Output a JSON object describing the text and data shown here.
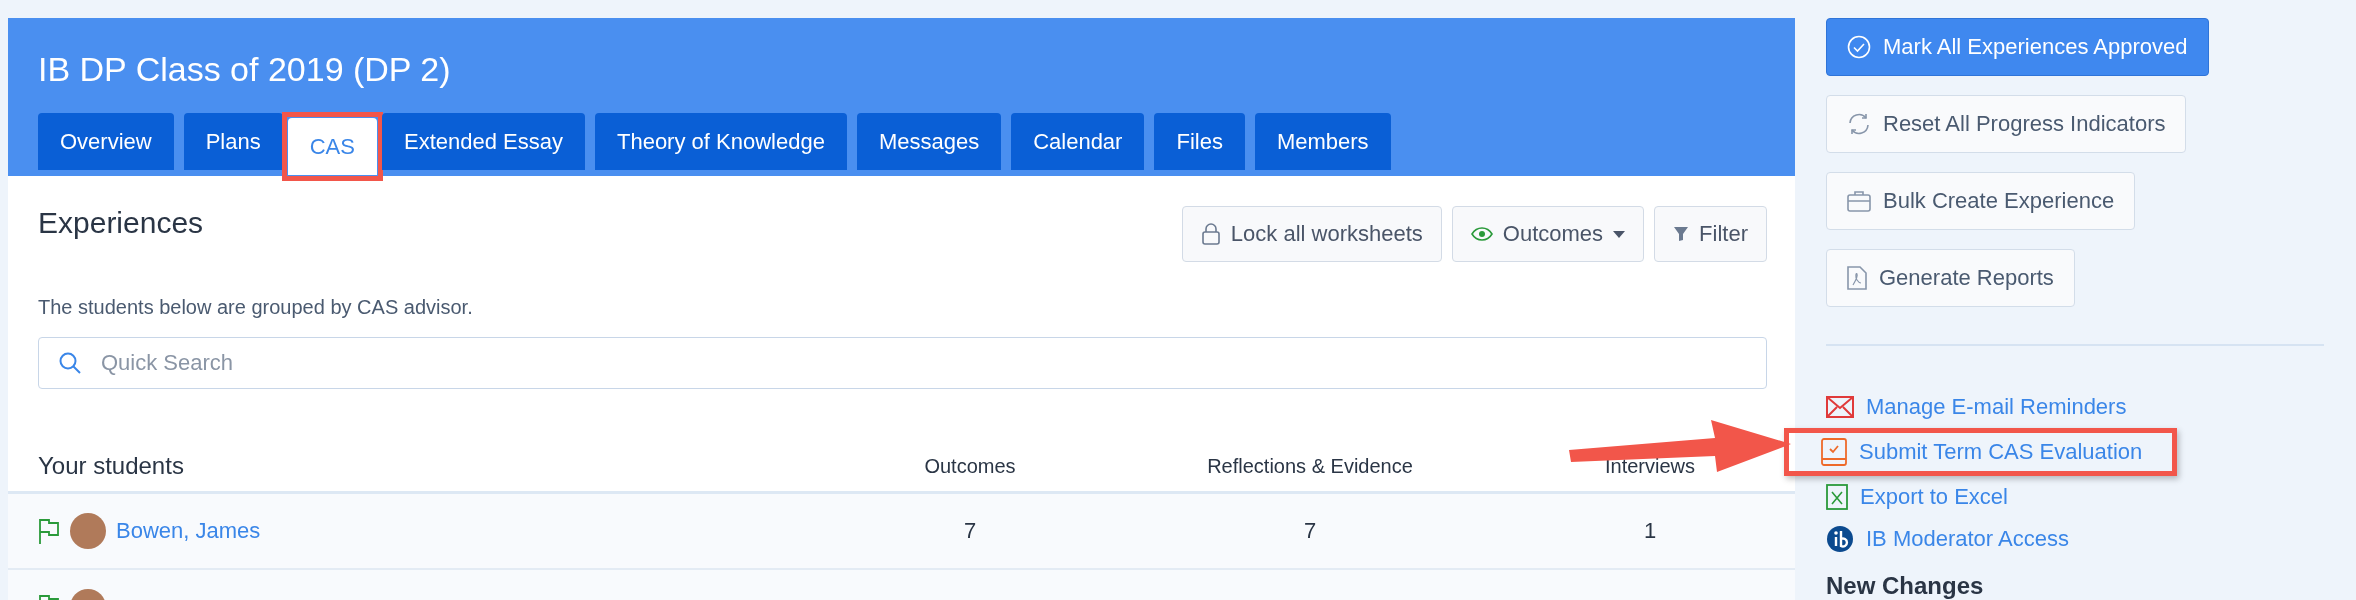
{
  "header": {
    "title": "IB DP Class of 2019 (DP 2)"
  },
  "tabs": [
    {
      "label": "Overview",
      "selected": false,
      "highlighted": false
    },
    {
      "label": "Plans",
      "selected": false,
      "highlighted": false
    },
    {
      "label": "CAS",
      "selected": true,
      "highlighted": true
    },
    {
      "label": "Extended Essay",
      "selected": false,
      "highlighted": false
    },
    {
      "label": "Theory of Knowledge",
      "selected": false,
      "highlighted": false
    },
    {
      "label": "Messages",
      "selected": false,
      "highlighted": false
    },
    {
      "label": "Calendar",
      "selected": false,
      "highlighted": false
    },
    {
      "label": "Files",
      "selected": false,
      "highlighted": false
    },
    {
      "label": "Members",
      "selected": false,
      "highlighted": false
    }
  ],
  "section": {
    "title": "Experiences",
    "description": "The students below are grouped by CAS advisor."
  },
  "toolbar": [
    {
      "kind": "lock",
      "label": "Lock all worksheets"
    },
    {
      "kind": "outcomes",
      "label": "Outcomes"
    },
    {
      "kind": "filter",
      "label": "Filter"
    }
  ],
  "search": {
    "placeholder": "Quick Search"
  },
  "table": {
    "columns": [
      "Your students",
      "Outcomes",
      "Reflections & Evidence",
      "Interviews"
    ],
    "rows": [
      {
        "name": "Bowen, James",
        "cells": [
          "7",
          "7",
          "1"
        ]
      },
      {}
    ]
  },
  "sidebar": {
    "buttons": [
      {
        "kind": "approve",
        "label": "Mark All Experiences Approved",
        "primary": true
      },
      {
        "kind": "reset",
        "label": "Reset All Progress Indicators",
        "primary": false
      },
      {
        "kind": "briefcase",
        "label": "Bulk Create Experience",
        "primary": false
      },
      {
        "kind": "pdf",
        "label": "Generate Reports",
        "primary": false
      }
    ],
    "links": [
      {
        "kind": "mail",
        "label": "Manage E-mail Reminders",
        "highlighted": false
      },
      {
        "kind": "evaluation",
        "label": "Submit Term CAS Evaluation",
        "highlighted": true
      },
      {
        "kind": "excel",
        "label": "Export to Excel",
        "highlighted": false
      },
      {
        "kind": "ib",
        "label": "IB Moderator Access",
        "highlighted": false
      }
    ],
    "subheading": "New Changes"
  }
}
